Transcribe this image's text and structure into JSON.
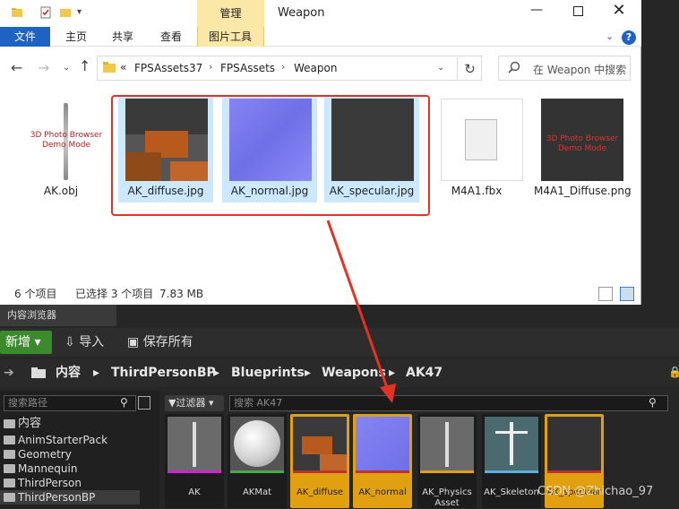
{
  "explorer": {
    "ribbon_tabs": [
      "文件",
      "主页",
      "共享",
      "查看",
      "图片工具"
    ],
    "context_tab": "管理",
    "window_title": "Weapon",
    "address": {
      "prefix": "«",
      "crumbs": [
        "FPSAssets37",
        "FPSAssets",
        "Weapon"
      ]
    },
    "search_placeholder": "在 Weapon 中搜索",
    "files": [
      {
        "name": "AK.obj",
        "selected": false
      },
      {
        "name": "AK_diffuse.jpg",
        "selected": true
      },
      {
        "name": "AK_normal.jpg",
        "selected": true
      },
      {
        "name": "AK_specular.jpg",
        "selected": true
      },
      {
        "name": "M4A1.fbx",
        "selected": false
      },
      {
        "name": "M4A1_Diffuse.png",
        "selected": false
      }
    ],
    "demo_watermark": "3D Photo Browser Demo Mode",
    "status": {
      "count": "6 个项目",
      "selected": "已选择 3 个项目",
      "size": "7.83 MB"
    }
  },
  "unreal": {
    "tab_label": "内容浏览器",
    "new_label": "新增",
    "import_label": "导入",
    "save_all_label": "保存所有",
    "path": [
      "内容",
      "ThirdPersonBP",
      "Blueprints",
      "Weapons",
      "AK47"
    ],
    "path_search_placeholder": "搜索路径",
    "filter_label": "过滤器",
    "asset_search_placeholder": "搜索 AK47",
    "tree": [
      "内容",
      "AnimStarterPack",
      "Geometry",
      "Mannequin",
      "ThirdPerson",
      "ThirdPersonBP"
    ],
    "assets": [
      {
        "name": "AK",
        "bar": "#d61fd6",
        "selected": false
      },
      {
        "name": "AKMat",
        "bar": "#4aa84a",
        "selected": false
      },
      {
        "name": "AK_diffuse",
        "bar": "#c03030",
        "selected": true
      },
      {
        "name": "AK_normal",
        "bar": "#c03030",
        "selected": true
      },
      {
        "name": "AK_Physics Asset",
        "bar": "#e0a010",
        "selected": false
      },
      {
        "name": "AK_Skeleton",
        "bar": "#5ab0e0",
        "selected": false
      },
      {
        "name": "AK_specular",
        "bar": "#c03030",
        "selected": true
      }
    ]
  },
  "watermark": "CSDN @Zhichao_97",
  "colors": {
    "accent_red": "#e53224",
    "ue_selected": "#e0a010",
    "ue_new_button": "#3b8a2e"
  }
}
